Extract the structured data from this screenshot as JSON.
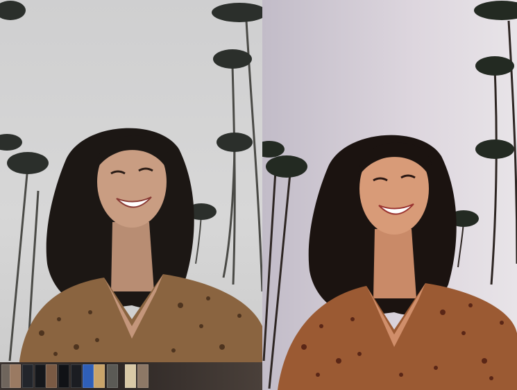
{
  "comparison": {
    "before_label": "",
    "after_label": ""
  },
  "filmstrip": {
    "thumbnails": [
      {
        "name": "thumb-1",
        "tone": "#6f655c"
      },
      {
        "name": "thumb-2",
        "tone": "#9a7a62"
      },
      {
        "name": "thumb-3",
        "tone": "#22252b"
      },
      {
        "name": "thumb-4",
        "tone": "#15171b"
      },
      {
        "name": "thumb-5",
        "tone": "#7a5a44"
      },
      {
        "name": "thumb-6",
        "tone": "#101216"
      },
      {
        "name": "thumb-7",
        "tone": "#1b1d22"
      },
      {
        "name": "thumb-8",
        "tone": "#2f5fb8"
      },
      {
        "name": "thumb-9",
        "tone": "#c9a46a"
      },
      {
        "name": "thumb-10",
        "tone": "#5b5a55"
      },
      {
        "name": "thumb-11",
        "tone": "#d9c9a6"
      },
      {
        "name": "thumb-12",
        "tone": "#8d7866"
      }
    ]
  },
  "colors": {
    "sky_before": "#d3d3d3",
    "sky_after": "#ddd6de",
    "hair": "#1b1512",
    "skin_before": "#c79a80",
    "skin_after": "#d79a78",
    "blouse_before": "#8a6440",
    "blouse_after": "#9b5a33",
    "palm": "#2a2d2a"
  }
}
